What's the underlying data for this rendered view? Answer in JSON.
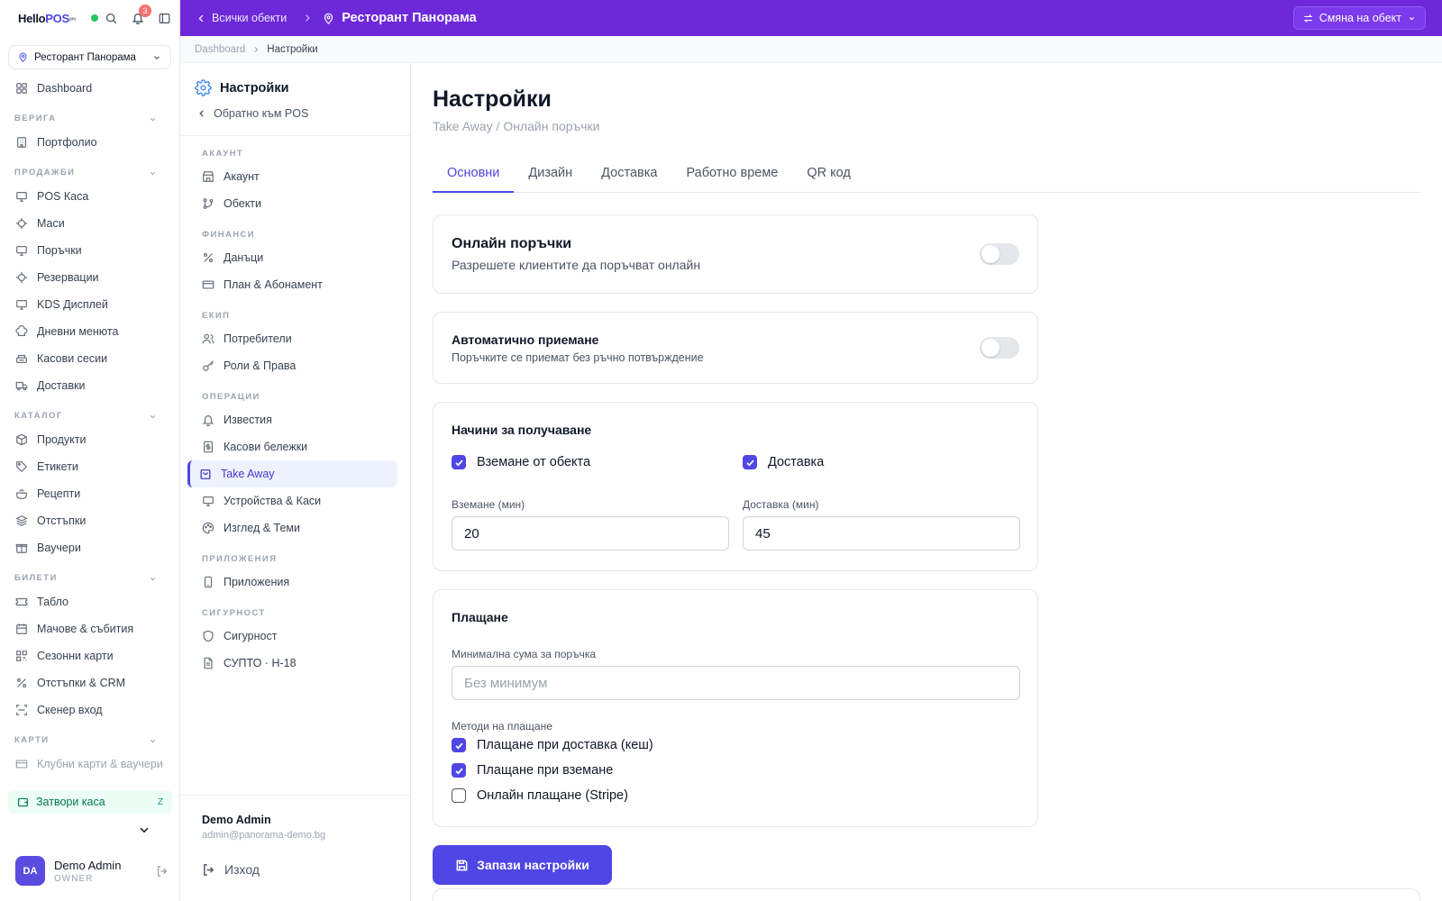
{
  "brand": {
    "logo_main": "Hello",
    "logo_accent": "POS",
    "logo_suffix": "pro"
  },
  "notifications": {
    "count": "3"
  },
  "venue_selector": {
    "label": "Ресторант Панорама"
  },
  "nav": {
    "dashboard": "Dashboard",
    "sections": [
      {
        "title": "ВЕРИГА",
        "items": [
          "Портфолио"
        ]
      },
      {
        "title": "ПРОДАЖБИ",
        "items": [
          "POS Каса",
          "Маси",
          "Поръчки",
          "Резервации",
          "KDS Дисплей",
          "Дневни менюта",
          "Касови сесии",
          "Доставки"
        ]
      },
      {
        "title": "КАТАЛОГ",
        "items": [
          "Продукти",
          "Етикети",
          "Рецепти",
          "Отстъпки",
          "Ваучери"
        ]
      },
      {
        "title": "БИЛЕТИ",
        "items": [
          "Табло",
          "Мачове & събития",
          "Сезонни карти",
          "Отстъпки & CRM",
          "Скенер вход"
        ]
      },
      {
        "title": "КАРТИ",
        "items": [
          "Клубни карти & ваучери"
        ]
      }
    ],
    "close_till": {
      "label": "Затвори каса",
      "shortcut": "Z"
    }
  },
  "current_user": {
    "initials": "DA",
    "name": "Demo Admin",
    "role": "OWNER",
    "email": "admin@panorama-demo.bg"
  },
  "topbar": {
    "back_label": "Всички обекти",
    "venue_title": "Ресторант Панорама",
    "change_venue": "Смяна на обект"
  },
  "breadcrumb": {
    "root": "Dashboard",
    "current": "Настройки"
  },
  "settings_nav": {
    "title": "Настройки",
    "back_label": "Обратно към POS",
    "groups": [
      {
        "title": "АКАУНТ",
        "items": [
          "Акаунт",
          "Обекти"
        ]
      },
      {
        "title": "ФИНАНСИ",
        "items": [
          "Данъци",
          "План & Абонамент"
        ]
      },
      {
        "title": "ЕКИП",
        "items": [
          "Потребители",
          "Роли & Права"
        ]
      },
      {
        "title": "ОПЕРАЦИИ",
        "items": [
          "Известия",
          "Касови бележки",
          "Take Away",
          "Устройства & Каси",
          "Изглед & Теми"
        ]
      },
      {
        "title": "ПРИЛОЖЕНИЯ",
        "items": [
          "Приложения"
        ]
      },
      {
        "title": "СИГУРНОСТ",
        "items": [
          "Сигурност",
          "СУПТО · Н-18"
        ]
      }
    ],
    "logout": "Изход"
  },
  "page": {
    "title": "Настройки",
    "subtitle": "Take Away / Онлайн поръчки",
    "tabs": [
      "Основни",
      "Дизайн",
      "Доставка",
      "Работно време",
      "QR код"
    ],
    "online_orders": {
      "title": "Онлайн поръчки",
      "desc": "Разрешете клиентите да поръчват онлайн",
      "enabled": false
    },
    "auto_accept": {
      "title": "Автоматично приемане",
      "desc": "Поръчките се приемат без ръчно потвърждение",
      "enabled": false
    },
    "fulfillment": {
      "title": "Начини за получаване",
      "pickup_label": "Вземане от обекта",
      "pickup_checked": true,
      "delivery_label": "Доставка",
      "delivery_checked": true,
      "pickup_time_label": "Вземане (мин)",
      "pickup_time_value": "20",
      "delivery_time_label": "Доставка (мин)",
      "delivery_time_value": "45"
    },
    "payment": {
      "title": "Плащане",
      "min_order_label": "Минимална сума за поръчка",
      "min_order_placeholder": "Без минимум",
      "methods_label": "Методи на плащане",
      "methods": [
        {
          "label": "Плащане при доставка (кеш)",
          "checked": true
        },
        {
          "label": "Плащане при вземане",
          "checked": true
        },
        {
          "label": "Онлайн плащане (Stripe)",
          "checked": false
        }
      ]
    },
    "save_button": "Запази настройки"
  },
  "colors": {
    "topbar": "#6d28d9",
    "accent": "#4f46e5",
    "success": "#047857"
  }
}
